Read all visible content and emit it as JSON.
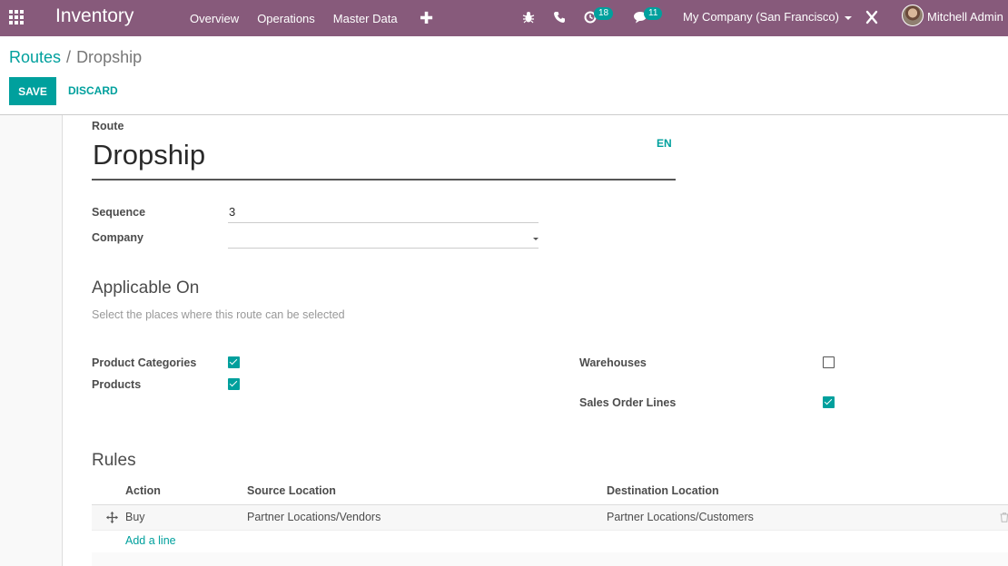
{
  "navbar": {
    "app_title": "Inventory",
    "menu": [
      "Overview",
      "Operations",
      "Master Data"
    ],
    "activity_count": "18",
    "messages_count": "11",
    "company": "My Company (San Francisco)",
    "user": "Mitchell Admin",
    "bg_color": "#875a7b"
  },
  "breadcrumb": {
    "parent": "Routes",
    "separator": "/",
    "current": "Dropship"
  },
  "buttons": {
    "save": "SAVE",
    "discard": "DISCARD"
  },
  "form": {
    "route_label": "Route",
    "route_name": "Dropship",
    "lang": "EN",
    "sequence_label": "Sequence",
    "sequence_value": "3",
    "company_label": "Company",
    "company_value": "",
    "applicable_title": "Applicable On",
    "applicable_help": "Select the places where this route can be selected",
    "product_categories_label": "Product Categories",
    "product_categories_checked": true,
    "products_label": "Products",
    "products_checked": true,
    "warehouses_label": "Warehouses",
    "warehouses_checked": false,
    "sale_lines_label": "Sales Order Lines",
    "sale_lines_checked": true
  },
  "rules": {
    "title": "Rules",
    "columns": [
      "Action",
      "Source Location",
      "Destination Location"
    ],
    "rows": [
      {
        "action": "Buy",
        "source": "Partner Locations/Vendors",
        "destination": "Partner Locations/Customers"
      }
    ],
    "add_line": "Add a line"
  },
  "accent_color": "#00a09d"
}
